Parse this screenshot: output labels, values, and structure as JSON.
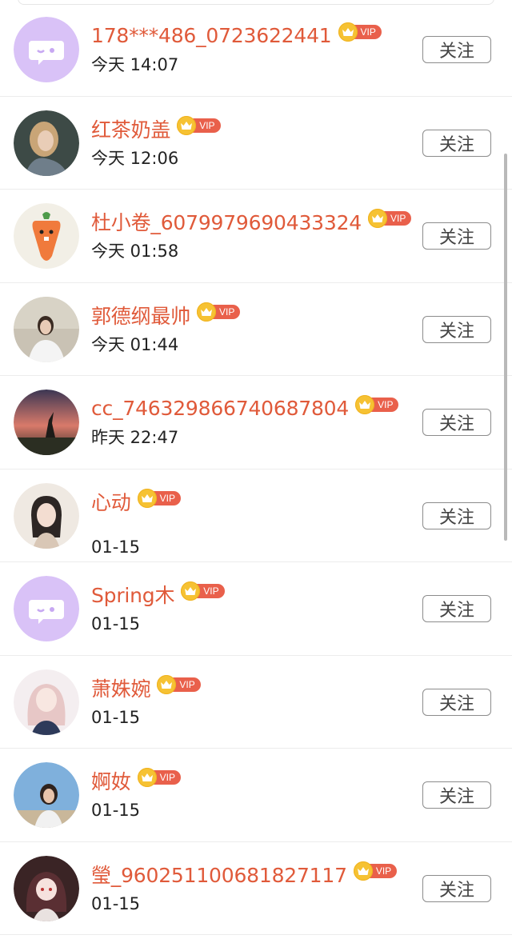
{
  "follow_label": "关注",
  "vip_label": "VIP",
  "colors": {
    "name": "#e05a3a",
    "vip_tag": "#e9604b",
    "crown": "#f6c233",
    "default_avatar_bg": "#d9c2f7"
  },
  "users": [
    {
      "name": "178***486_0723622441",
      "time": "今天 14:07",
      "avatar": "default-purple-avatar"
    },
    {
      "name": "红茶奶盖",
      "time": "今天 12:06",
      "avatar": "photo-avatar"
    },
    {
      "name": "杜小卷_6079979690433324",
      "time": "今天 01:58",
      "avatar": "carrot-avatar"
    },
    {
      "name": "郭德纲最帅",
      "time": "今天 01:44",
      "avatar": "photo-avatar"
    },
    {
      "name": "cc_746329866740687804",
      "time": "昨天 22:47",
      "avatar": "sunset-photo-avatar"
    },
    {
      "name": "心动",
      "time": "01-15",
      "avatar": "illustration-avatar"
    },
    {
      "name": "Spring木",
      "time": "01-15",
      "avatar": "default-purple-avatar"
    },
    {
      "name": "萧姝婉",
      "time": "01-15",
      "avatar": "anime-avatar"
    },
    {
      "name": "婀奻",
      "time": "01-15",
      "avatar": "photo-avatar"
    },
    {
      "name": "瑩_960251100681827117",
      "time": "01-15",
      "avatar": "anime-avatar"
    }
  ]
}
